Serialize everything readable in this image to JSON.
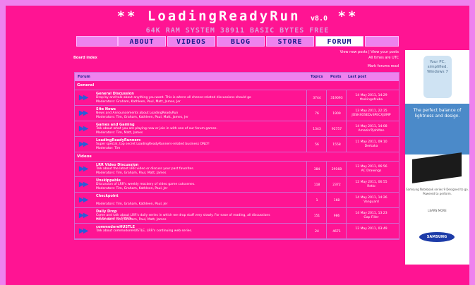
{
  "header": {
    "logo_prefix": "** ",
    "logo_text": "LoadingReadyRun",
    "version": "v8.0",
    "logo_suffix": " **",
    "tagline": "64K RAM SYSTEM 38911 BASIC BYTES FREE"
  },
  "nav": [
    {
      "label": ""
    },
    {
      "label": "ABOUT"
    },
    {
      "label": "VIDEOS"
    },
    {
      "label": "BLOG"
    },
    {
      "label": "STORE"
    },
    {
      "label": "FORUM"
    },
    {
      "label": ""
    }
  ],
  "board_index": "Board index",
  "view_links": "View new posts | View your posts",
  "time_note": "All times are UTC",
  "mark_read": "Mark forums read",
  "table": {
    "col_forum": "Forum",
    "col_topics": "Topics",
    "col_posts": "Posts",
    "col_last": "Last post"
  },
  "categories": [
    {
      "name": "General",
      "forums": [
        {
          "title": "General Discussion",
          "desc": "Drop by and talk about anything you want. This is where all cheese-related discussions should go",
          "mods": "Moderators: Graham, Kathleen, Paul, Matt, James, Jer",
          "topics": "3744",
          "posts": "319093",
          "last_date": "14 May 2011, 14:29",
          "last_user": "thekingofcuba"
        },
        {
          "title": "Site News",
          "desc": "News and Announcements about LoadingReadyRun",
          "mods": "Moderators: Tim, Graham, Kathleen, Paul, Matt, James, Jer",
          "topics": "76",
          "posts": "1909",
          "last_date": "13 May 2011, 22:35",
          "last_user": "JOSHXOSEDvSPECXJUMP"
        },
        {
          "title": "Games and Gaming",
          "desc": "Talk about what you are playing now or join in with one of our forum games.",
          "mods": "Moderators: Tim, Matt, James",
          "topics": "1343",
          "posts": "92757",
          "last_date": "14 May 2011, 14:08",
          "last_user": "Amazin'PjohMan"
        },
        {
          "title": "LoadingReadyRunners",
          "desc": "Super special, top secret LoadingReadyRunners-related business ONLY!",
          "mods": "Moderator: Tim",
          "topics": "56",
          "posts": "1558",
          "last_date": "11 May 2011, 09:10",
          "last_user": "Derkaka"
        }
      ]
    },
    {
      "name": "Videos",
      "forums": [
        {
          "title": "LRR Video Discussion",
          "desc": "Talk about the latest LRR video or discuss your past favorites.",
          "mods": "Moderators: Tim, Graham, Paul, Matt, James",
          "topics": "384",
          "posts": "29168",
          "last_date": "13 May 2011, 06:56",
          "last_user": "AC Drawings"
        },
        {
          "title": "Unskippable",
          "desc": "Discussion of LRR's weekly mockery of video game cutscenes.",
          "mods": "Moderators: Tim, Graham, Kathleen, Paul, Jer",
          "topics": "118",
          "posts": "2372",
          "last_date": "12 May 2011, 06:55",
          "last_user": "Retlo"
        },
        {
          "title": "Checkpoint",
          "desc": "",
          "mods": "Moderators: Tim, Graham, Kathleen, Paul, Jer",
          "topics": "1",
          "posts": "168",
          "last_date": "14 May 2011, 14:26",
          "last_user": "Vanguard"
        },
        {
          "title": "Daily Drop",
          "desc": "Come and talk about LRR's daily series in which we drop stuff very slowly. For ease of reading, all discussions will be sped up 6000%.",
          "mods": "Moderators: Tim, Graham, Paul, Matt, James",
          "topics": "151",
          "posts": "986",
          "last_date": "14 May 2011, 13:23",
          "last_user": "Gap Filler"
        },
        {
          "title": "commodoreHUSTLE",
          "desc": "Talk about commodoreHUSTLE, LRR's continuing web series.",
          "mods": "",
          "topics": "24",
          "posts": "4671",
          "last_date": "12 May 2011, 03:49",
          "last_user": ""
        }
      ]
    }
  ],
  "ad": {
    "top": "Your PC, simplified. Windows 7",
    "mid": "The perfect balance of lightness and design.",
    "bot": "Samsung Notebook series 9  Designed to go. Powered to perform.",
    "learn": "LEARN MORE",
    "brand": "SAMSUNG"
  }
}
